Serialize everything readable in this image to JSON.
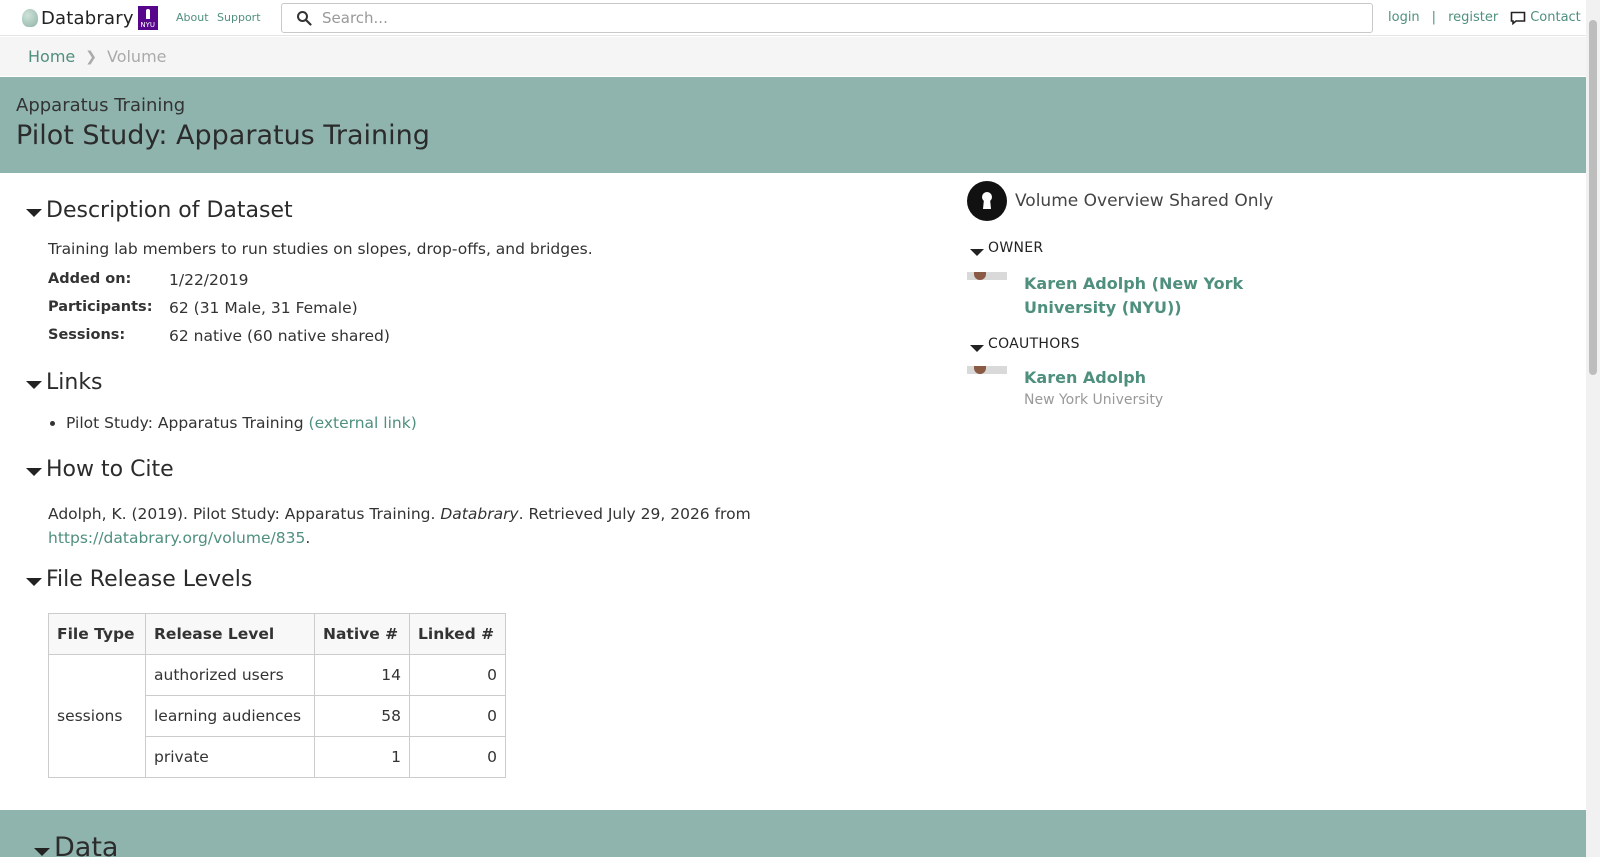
{
  "nav": {
    "brand": "Databrary",
    "institution": "NYU",
    "about": "About",
    "support": "Support",
    "search_placeholder": "Search...",
    "login": "login",
    "register": "register",
    "sep": "|",
    "contact": "Contact"
  },
  "breadcrumb": {
    "home": "Home",
    "current": "Volume"
  },
  "volume": {
    "short_title": "Apparatus Training",
    "title": "Pilot Study: Apparatus Training"
  },
  "description": {
    "heading": "Description of Dataset",
    "text": "Training lab members to run studies on slopes, drop-offs, and bridges.",
    "added_label": "Added on:",
    "added_value": "1/22/2019",
    "participants_label": "Participants:",
    "participants_value": "62 (31 Male, 31 Female)",
    "sessions_label": "Sessions:",
    "sessions_value": "62 native (60 native shared)"
  },
  "links": {
    "heading": "Links",
    "items": [
      {
        "text": "Pilot Study: Apparatus Training",
        "link": "(external link)"
      }
    ]
  },
  "cite": {
    "heading": "How to Cite",
    "prefix": "Adolph, K. (2019). Pilot Study: Apparatus Training. ",
    "journal": "Databrary",
    "middle": ". Retrieved July 29, 2026 from ",
    "url": "https://databrary.org/volume/835",
    "suffix": "."
  },
  "release": {
    "heading": "File Release Levels",
    "columns": [
      "File Type",
      "Release Level",
      "Native #",
      "Linked #"
    ],
    "file_type": "sessions",
    "rows": [
      {
        "level": "authorized users",
        "native": "14",
        "linked": "0"
      },
      {
        "level": "learning audiences",
        "native": "58",
        "linked": "0"
      },
      {
        "level": "private",
        "native": "1",
        "linked": "0"
      }
    ]
  },
  "data_section": {
    "heading": "Data"
  },
  "sidebar": {
    "sharing": "Volume Overview Shared Only",
    "owner_heading": "OWNER",
    "owner_name": "Karen Adolph (New York University (NYU))",
    "coauthors_heading": "COAUTHORS",
    "coauthor_name": "Karen Adolph",
    "coauthor_affiliation": "New York University"
  },
  "colors": {
    "accent": "#4f8f7e",
    "header_bg": "#8fb4ae"
  }
}
